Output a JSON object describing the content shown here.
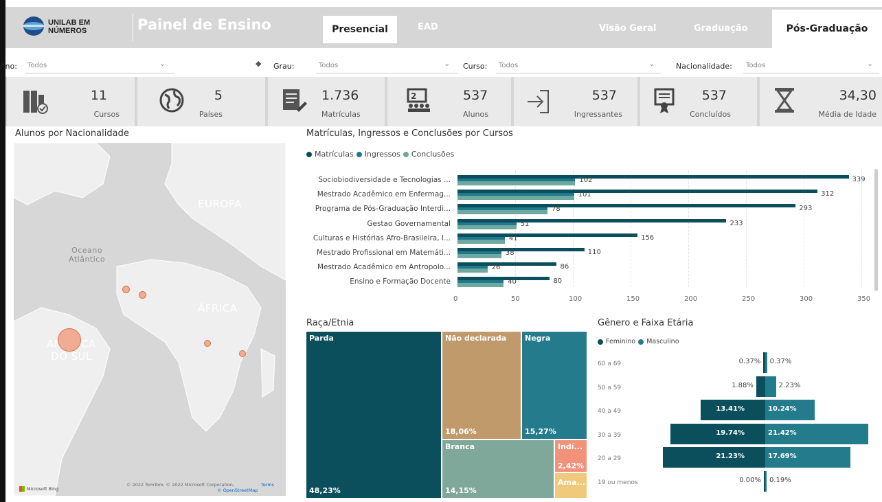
{
  "header": {
    "logo_line1": "UNILAB EM",
    "logo_line2": "NÚMEROS",
    "title": "Painel de Ensino",
    "tabs": [
      "Presencial",
      "EAD",
      "Visão Geral",
      "Graduação",
      "Pós-Graduação"
    ],
    "active_modality": "Presencial",
    "active_level": "Pós-Graduação"
  },
  "filters": {
    "ano_label": "Ano:",
    "ano_value": "Todos",
    "grau_label": "Grau:",
    "grau_value": "Todos",
    "curso_label": "Curso:",
    "curso_value": "Todos",
    "nac_label": "Nacionalidade:",
    "nac_value": "Todos",
    "eraser_icon": "eraser-icon"
  },
  "kpis": [
    {
      "value": "11",
      "label": "Cursos",
      "icon": "books-icon"
    },
    {
      "value": "5",
      "label": "Países",
      "icon": "globe-icon"
    },
    {
      "value": "1.736",
      "label": "Matrículas",
      "icon": "document-pen-icon"
    },
    {
      "value": "537",
      "label": "Alunos",
      "icon": "classroom-icon"
    },
    {
      "value": "537",
      "label": "Ingressantes",
      "icon": "enter-arrow-icon"
    },
    {
      "value": "537",
      "label": "Concluídos",
      "icon": "certificate-icon"
    },
    {
      "value": "34,30",
      "label": "Média de Idade",
      "icon": "hourglass-icon"
    }
  ],
  "map": {
    "title": "Alunos por Nacionalidade",
    "labels": [
      "EUROPA",
      "Oceano\nAtlântico",
      "ÁFRICA",
      "AMÉRICA\nDO SUL"
    ],
    "credit": "© 2022 TomTom, © 2022 Microsoft Corporation,",
    "terms": "Terms",
    "osm": "© OpenStreetMap",
    "bing": "Microsoft Bing"
  },
  "bar_chart": {
    "title": "Matrículas, Ingressos e Conclusões por Cursos",
    "colors": {
      "matriculas": "#0b4f5c",
      "ingressos": "#1e7a8c",
      "conclusoes": "#6fa89f"
    },
    "chart_data": {
      "type": "bar",
      "orientation": "horizontal",
      "categories": [
        "Sociobiodiversidade e Tecnologias ...",
        "Mestrado Acadêmico em Enfermag...",
        "Programa de Pós-Graduação Interdi...",
        "Gestao Governamental",
        "Culturas e Histórias Afro-Brasileira, I...",
        "Mestrado Profissional em Matemáti...",
        "Mestrado Acadêmico em Antropolo...",
        "Ensino e Formação Docente"
      ],
      "series": [
        {
          "name": "Matrículas",
          "values": [
            339,
            312,
            293,
            233,
            156,
            110,
            86,
            80
          ]
        },
        {
          "name": "Ingressos",
          "values": [
            102,
            101,
            78,
            51,
            41,
            38,
            26,
            40
          ]
        },
        {
          "name": "Conclusões",
          "values": [
            102,
            101,
            78,
            51,
            41,
            38,
            26,
            40
          ]
        }
      ],
      "xticks": [
        "0",
        "50",
        "100",
        "150",
        "200",
        "250",
        "300",
        "350"
      ],
      "xlim": [
        0,
        350
      ]
    }
  },
  "treemap": {
    "title": "Raça/Etnia",
    "items": [
      {
        "label": "Parda",
        "pct": "48,23%",
        "color": "#0b4f5c"
      },
      {
        "label": "Não declarada",
        "pct": "18,06%",
        "color": "#c19a6b"
      },
      {
        "label": "Negra",
        "pct": "15,27%",
        "color": "#237b8c"
      },
      {
        "label": "Branca",
        "pct": "14,15%",
        "color": "#7fa79a"
      },
      {
        "label": "Indí...",
        "pct": "2,42%",
        "color": "#f0937a"
      },
      {
        "label": "Ama...",
        "pct": "",
        "color": "#f1c97a"
      }
    ]
  },
  "pyramid": {
    "title": "Gênero e Faixa Etária",
    "legend": [
      "Feminino",
      "Masculino"
    ],
    "colors": {
      "feminino": "#0b4f5c",
      "masculino": "#237b8c"
    },
    "chart_data": {
      "type": "bar",
      "orientation": "horizontal-diverging",
      "categories": [
        "60 a 69",
        "50 a 59",
        "40 a 49",
        "30 a 39",
        "20 a 29",
        "19 ou menos"
      ],
      "series": [
        {
          "name": "Feminino",
          "values": [
            0.37,
            1.88,
            13.41,
            19.74,
            21.23,
            0.0
          ],
          "labels": [
            "0.37%",
            "1.88%",
            "13.41%",
            "19.74%",
            "21.23%",
            "0.00%"
          ]
        },
        {
          "name": "Masculino",
          "values": [
            0.37,
            2.23,
            10.24,
            21.42,
            17.69,
            0.19
          ],
          "labels": [
            "0.37%",
            "2.23%",
            "10.24%",
            "21.42%",
            "17.69%",
            "0.19%"
          ]
        }
      ]
    }
  }
}
